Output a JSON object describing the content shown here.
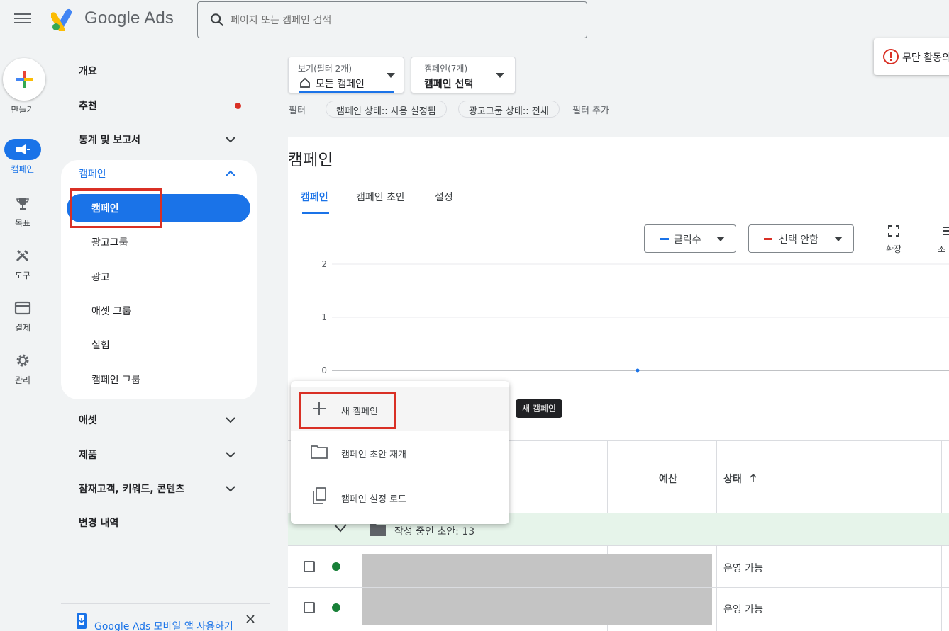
{
  "header": {
    "brand": "Google Ads",
    "search_placeholder": "페이지 또는 캠페인 검색"
  },
  "rail": {
    "create_label": "만들기",
    "items": [
      {
        "label": "캠페인",
        "icon": "megaphone-icon"
      },
      {
        "label": "목표",
        "icon": "trophy-icon"
      },
      {
        "label": "도구",
        "icon": "tools-icon"
      },
      {
        "label": "결제",
        "icon": "credit-card-icon"
      },
      {
        "label": "관리",
        "icon": "gear-icon"
      }
    ]
  },
  "nav": {
    "overview": "개요",
    "recommendations": "추천",
    "stats_reports": "통계 및 보고서",
    "campaigns_section": "캠페인",
    "campaigns_sub": [
      "캠페인",
      "광고그룹",
      "광고",
      "애셋 그룹",
      "실험",
      "캠페인 그룹"
    ],
    "assets": "애셋",
    "products": "제품",
    "audiences": "잠재고객, 키워드, 콘텐츠",
    "change_history": "변경 내역",
    "mobile_app": "Google Ads 모바일 앱 사용하기"
  },
  "filters": {
    "view_label": "보기(필터 2개)",
    "view_value": "모든 캠페인",
    "campaign_label": "캠페인(7개)",
    "campaign_value": "캠페인 선택",
    "filter_label": "필터",
    "chips": [
      "캠페인 상태:: 사용 설정됨",
      "광고그룹 상태:: 전체"
    ],
    "add_filter": "필터 추가"
  },
  "alert": {
    "text": "무단 활동의"
  },
  "page": {
    "title": "캠페인",
    "tabs": [
      "캠페인",
      "캠페인 초안",
      "설정"
    ]
  },
  "chart": {
    "metric1": "클릭수",
    "metric2": "선택 안함",
    "expand": "확장",
    "adjust": "조",
    "metric1_color": "#1a73e8",
    "metric2_color": "#d93025"
  },
  "chart_data": {
    "type": "line",
    "y_ticks": [
      "2",
      "1",
      "0"
    ],
    "ylim": [
      0,
      2
    ],
    "series": [
      {
        "name": "클릭수",
        "values": [
          0
        ]
      }
    ]
  },
  "menu": {
    "items": [
      {
        "label": "새 캠페인",
        "icon": "plus-icon"
      },
      {
        "label": "캠페인 초안 재개",
        "icon": "folder-icon"
      },
      {
        "label": "캠페인 설정 로드",
        "icon": "copy-icon"
      }
    ],
    "tooltip": "새 캠페인"
  },
  "table": {
    "col_budget": "예산",
    "col_status": "상태",
    "draft_row": "작성 중인 초안: 13",
    "rows": [
      {
        "status": "운영 가능"
      },
      {
        "status": "운영 가능"
      }
    ]
  }
}
